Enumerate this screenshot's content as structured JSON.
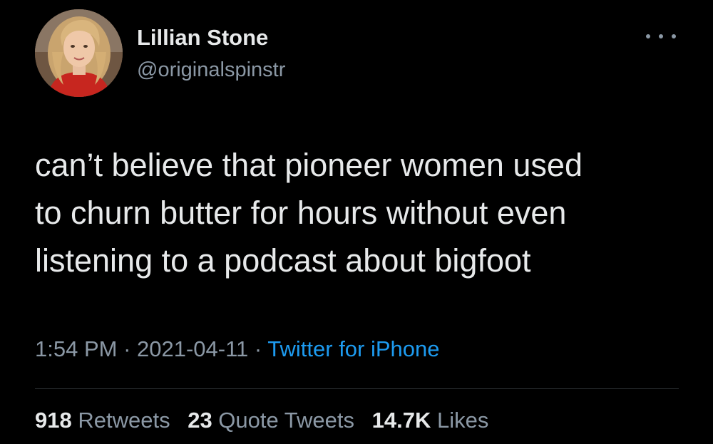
{
  "author": {
    "name": "Lillian Stone",
    "handle": "@originalspinstr"
  },
  "tweet": {
    "lines": [
      "can’t believe that pioneer women used",
      "to churn butter for hours without even",
      "listening to a podcast about bigfoot"
    ]
  },
  "meta": {
    "time": "1:54 PM",
    "sep1": " · ",
    "date": "2021-04-11",
    "sep2": " · ",
    "source": "Twitter for iPhone"
  },
  "stats": {
    "retweets_count": "918",
    "retweets_label": " Retweets",
    "quotes_count": "23",
    "quotes_label": " Quote Tweets",
    "likes_count": "14.7K",
    "likes_label": " Likes"
  },
  "colors": {
    "background": "#000000",
    "text": "#e7e9ea",
    "muted": "#8b98a5",
    "link": "#1d9bf0",
    "divider": "#2f3336"
  },
  "icons": {
    "more": "more-horizontal-icon"
  }
}
